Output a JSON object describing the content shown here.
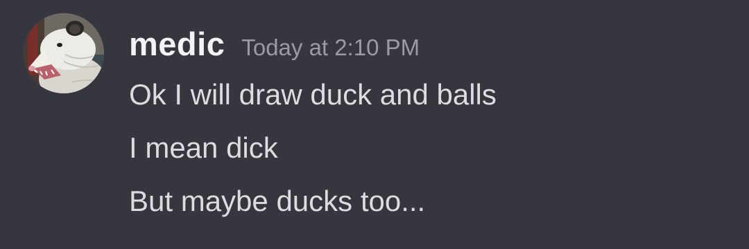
{
  "author": {
    "username": "medic",
    "avatar_icon": "opossum-avatar"
  },
  "timestamp": "Today at 2:10 PM",
  "messages": [
    "Ok I will draw duck and balls",
    "I mean dick",
    "But maybe ducks too..."
  ],
  "colors": {
    "background": "#36363f",
    "username": "#f2f3f5",
    "timestamp": "#9a9ca3",
    "message_text": "#dcdde1"
  }
}
